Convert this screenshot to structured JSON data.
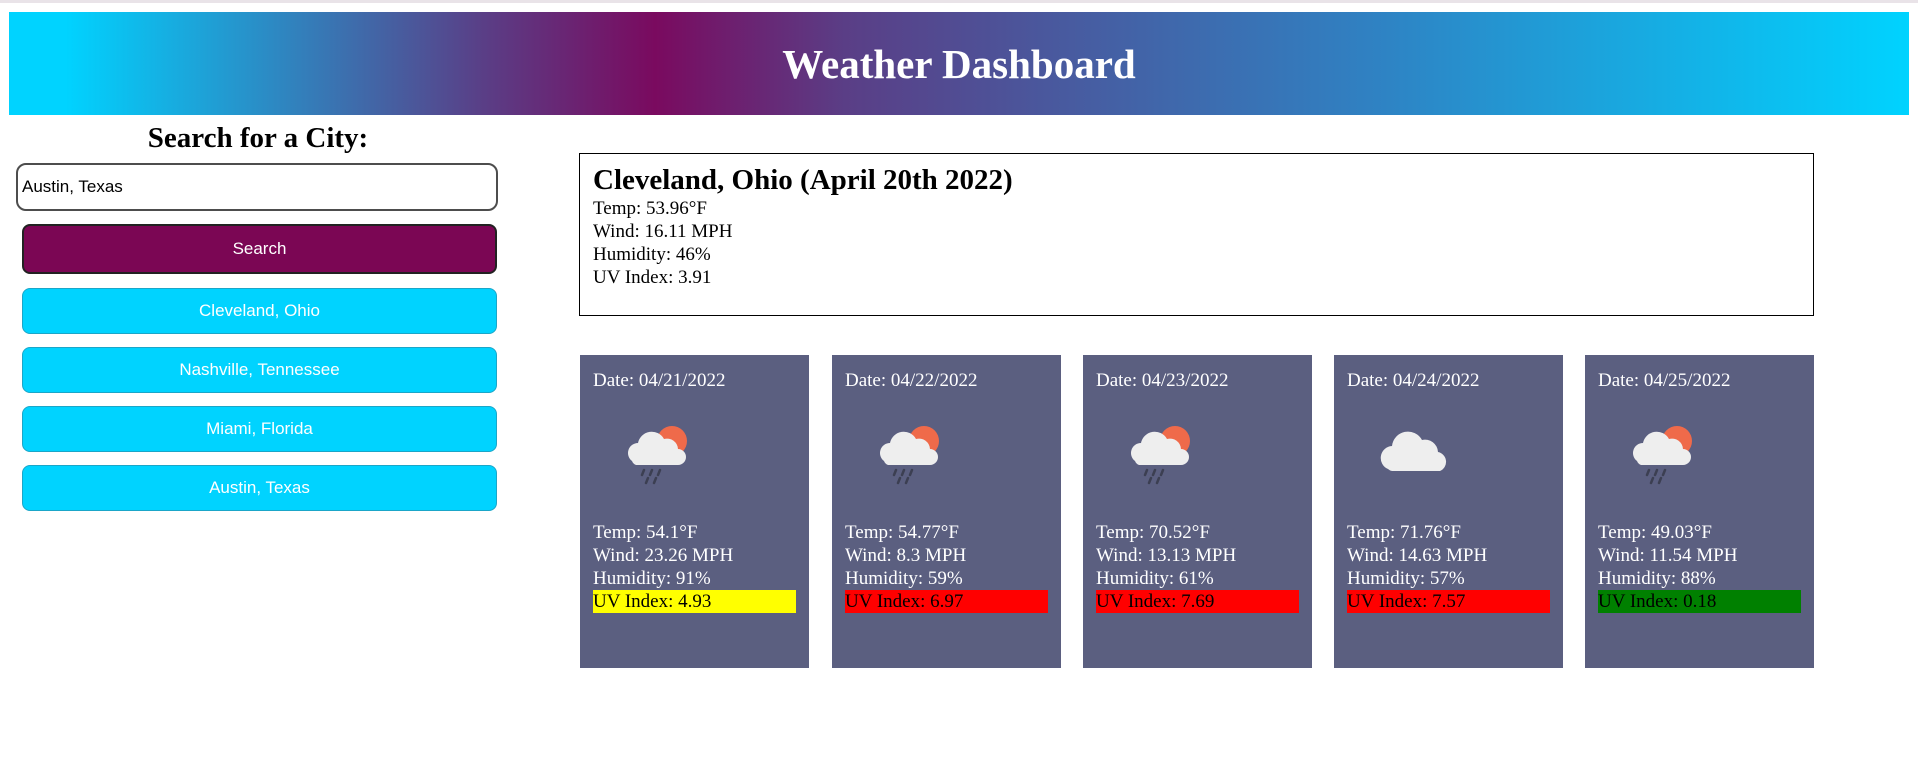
{
  "header": {
    "title": "Weather Dashboard"
  },
  "search": {
    "heading": "Search for a City:",
    "input_value": "Austin, Texas",
    "button_label": "Search"
  },
  "history": [
    {
      "label": "Cleveland, Ohio"
    },
    {
      "label": "Nashville, Tennessee"
    },
    {
      "label": "Miami, Florida"
    },
    {
      "label": "Austin, Texas"
    }
  ],
  "current": {
    "title": "Cleveland, Ohio (April 20th 2022)",
    "temp": "Temp: 53.96°F",
    "wind": "Wind: 16.11 MPH",
    "humidity": "Humidity: 46%",
    "uv": "UV Index: 3.91"
  },
  "forecast": [
    {
      "date": "Date: 04/21/2022",
      "icon": "cloud-sun-rain-icon",
      "temp": "Temp: 54.1°F",
      "wind": "Wind: 23.26 MPH",
      "humidity": "Humidity: 91%",
      "uv": "UV Index: 4.93",
      "uv_color": "#ffff00"
    },
    {
      "date": "Date: 04/22/2022",
      "icon": "cloud-sun-rain-icon",
      "temp": "Temp: 54.77°F",
      "wind": "Wind: 8.3 MPH",
      "humidity": "Humidity: 59%",
      "uv": "UV Index: 6.97",
      "uv_color": "#ff0000"
    },
    {
      "date": "Date: 04/23/2022",
      "icon": "cloud-sun-rain-icon",
      "temp": "Temp: 70.52°F",
      "wind": "Wind: 13.13 MPH",
      "humidity": "Humidity: 61%",
      "uv": "UV Index: 7.69",
      "uv_color": "#ff0000"
    },
    {
      "date": "Date: 04/24/2022",
      "icon": "cloud-icon",
      "temp": "Temp: 71.76°F",
      "wind": "Wind: 14.63 MPH",
      "humidity": "Humidity: 57%",
      "uv": "UV Index: 7.57",
      "uv_color": "#ff0000"
    },
    {
      "date": "Date: 04/25/2022",
      "icon": "cloud-sun-rain-icon",
      "temp": "Temp: 49.03°F",
      "wind": "Wind: 11.54 MPH",
      "humidity": "Humidity: 88%",
      "uv": "UV Index: 0.18",
      "uv_color": "#008000"
    }
  ],
  "colors": {
    "header_gradient": [
      "#00d3ff",
      "#7a0a5f",
      "#00d3ff"
    ],
    "search_button": "#7b0654",
    "history_button": "#00d3ff",
    "card_background": "#5b5f80"
  }
}
